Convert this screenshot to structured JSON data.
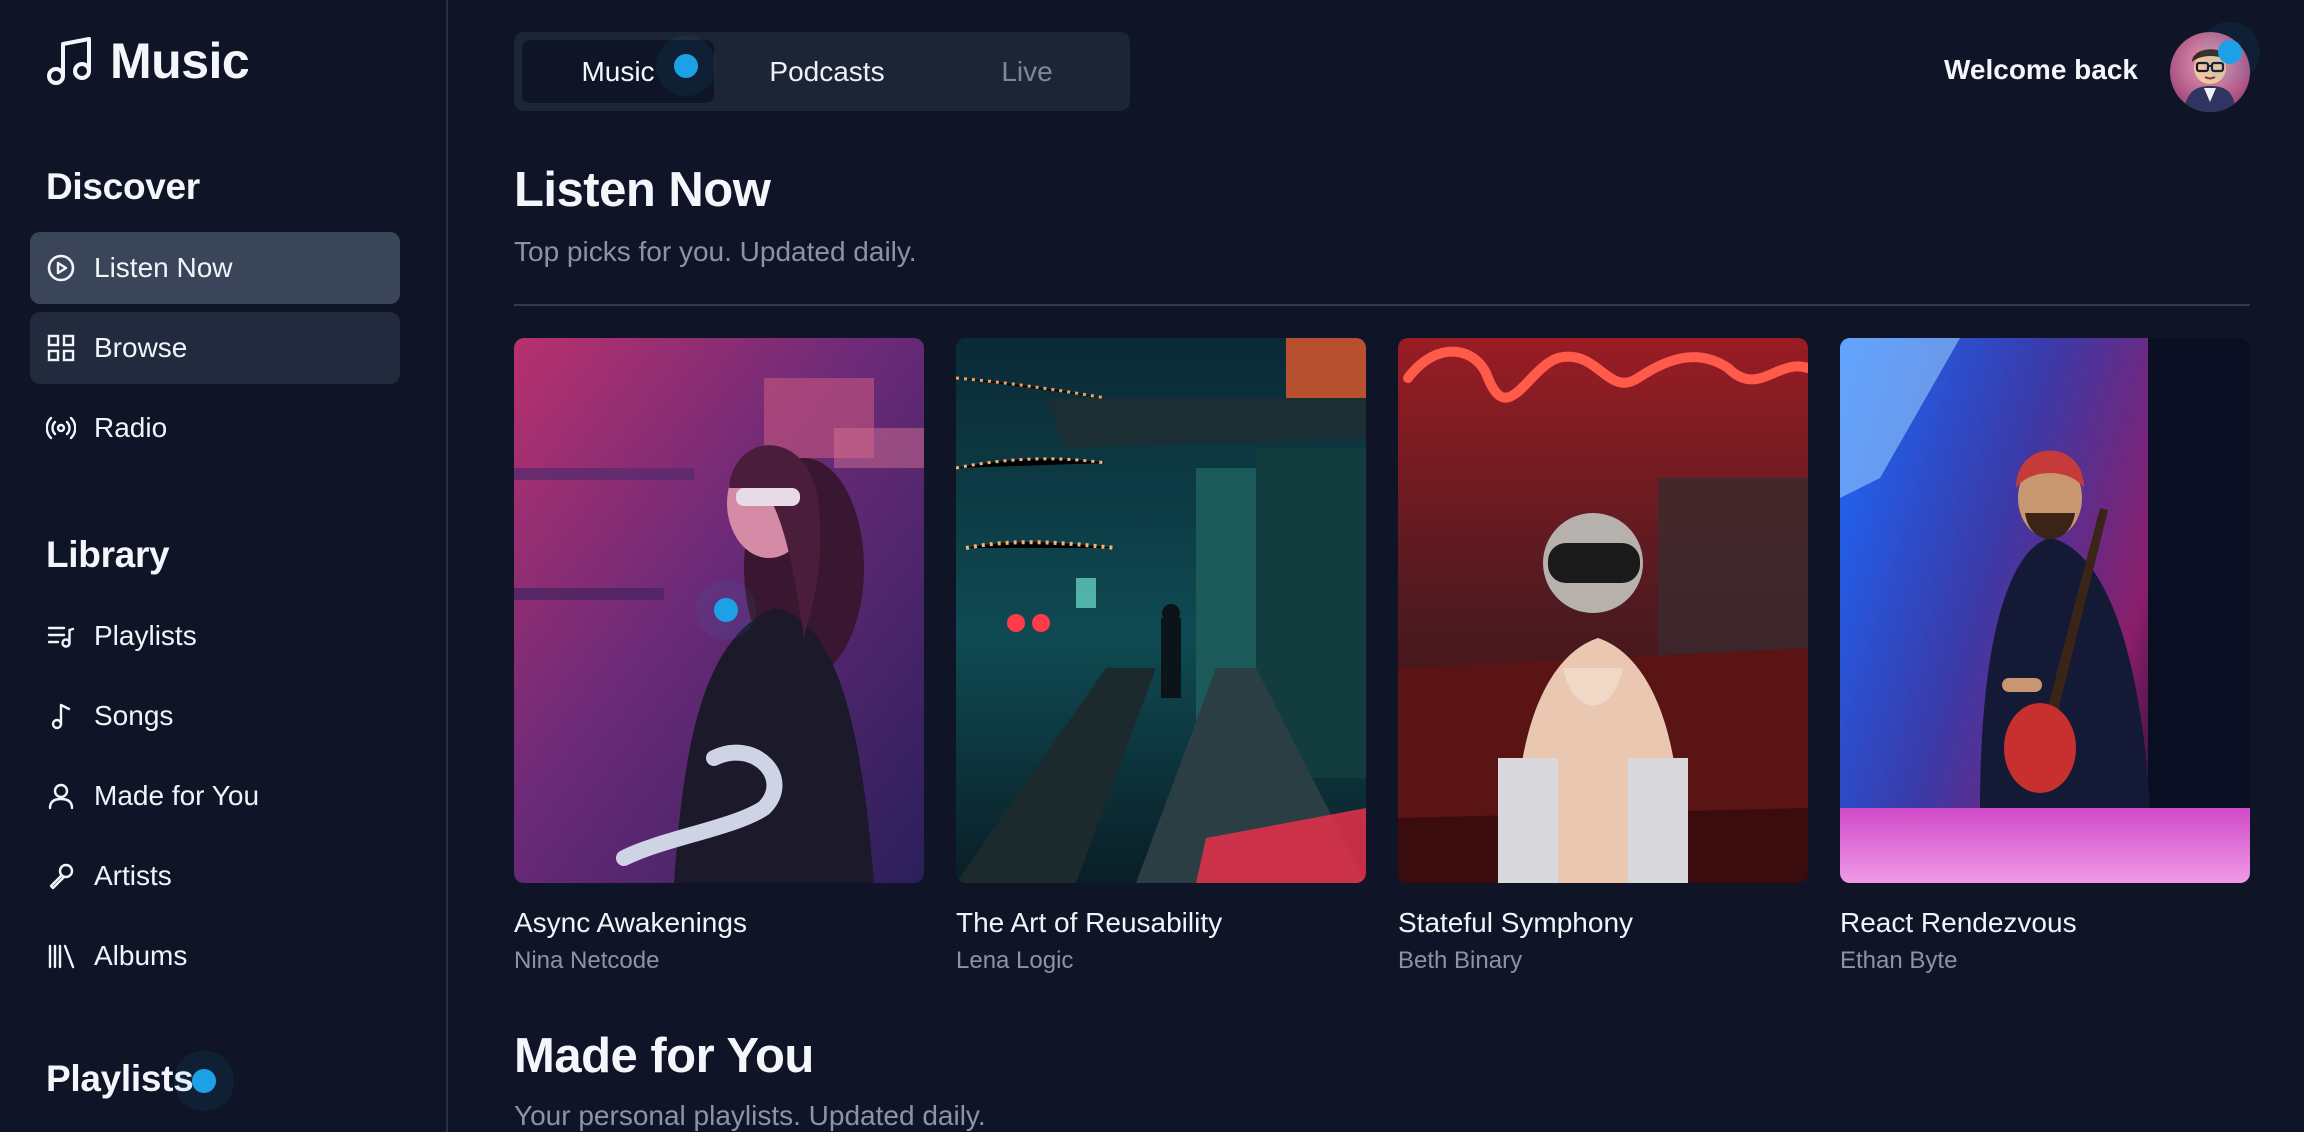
{
  "brand": {
    "title": "Music"
  },
  "sidebar": {
    "discover_title": "Discover",
    "discover_items": [
      {
        "label": "Listen Now",
        "icon": "play-circle-icon",
        "state": "active"
      },
      {
        "label": "Browse",
        "icon": "grid-icon",
        "state": "hover"
      },
      {
        "label": "Radio",
        "icon": "radio-icon",
        "state": "normal"
      }
    ],
    "library_title": "Library",
    "library_items": [
      {
        "label": "Playlists",
        "icon": "playlist-icon"
      },
      {
        "label": "Songs",
        "icon": "music-note-icon"
      },
      {
        "label": "Made for You",
        "icon": "user-icon"
      },
      {
        "label": "Artists",
        "icon": "microphone-icon"
      },
      {
        "label": "Albums",
        "icon": "library-icon"
      }
    ],
    "playlists_title": "Playlists"
  },
  "tabs": [
    {
      "label": "Music",
      "state": "active"
    },
    {
      "label": "Podcasts",
      "state": "normal"
    },
    {
      "label": "Live",
      "state": "disabled"
    }
  ],
  "header": {
    "welcome": "Welcome back"
  },
  "listen_now": {
    "title": "Listen Now",
    "subtitle": "Top picks for you. Updated daily.",
    "albums": [
      {
        "title": "Async Awakenings",
        "artist": "Nina Netcode"
      },
      {
        "title": "The Art of Reusability",
        "artist": "Lena Logic"
      },
      {
        "title": "Stateful Symphony",
        "artist": "Beth Binary"
      },
      {
        "title": "React Rendezvous",
        "artist": "Ethan Byte"
      }
    ]
  },
  "made_for_you": {
    "title": "Made for You",
    "subtitle": "Your personal playlists. Updated daily."
  },
  "colors": {
    "background": "#0f1526",
    "accent_dot": "#1da1e6",
    "active_item": "#3a4559",
    "muted_text": "#8b93a5"
  }
}
